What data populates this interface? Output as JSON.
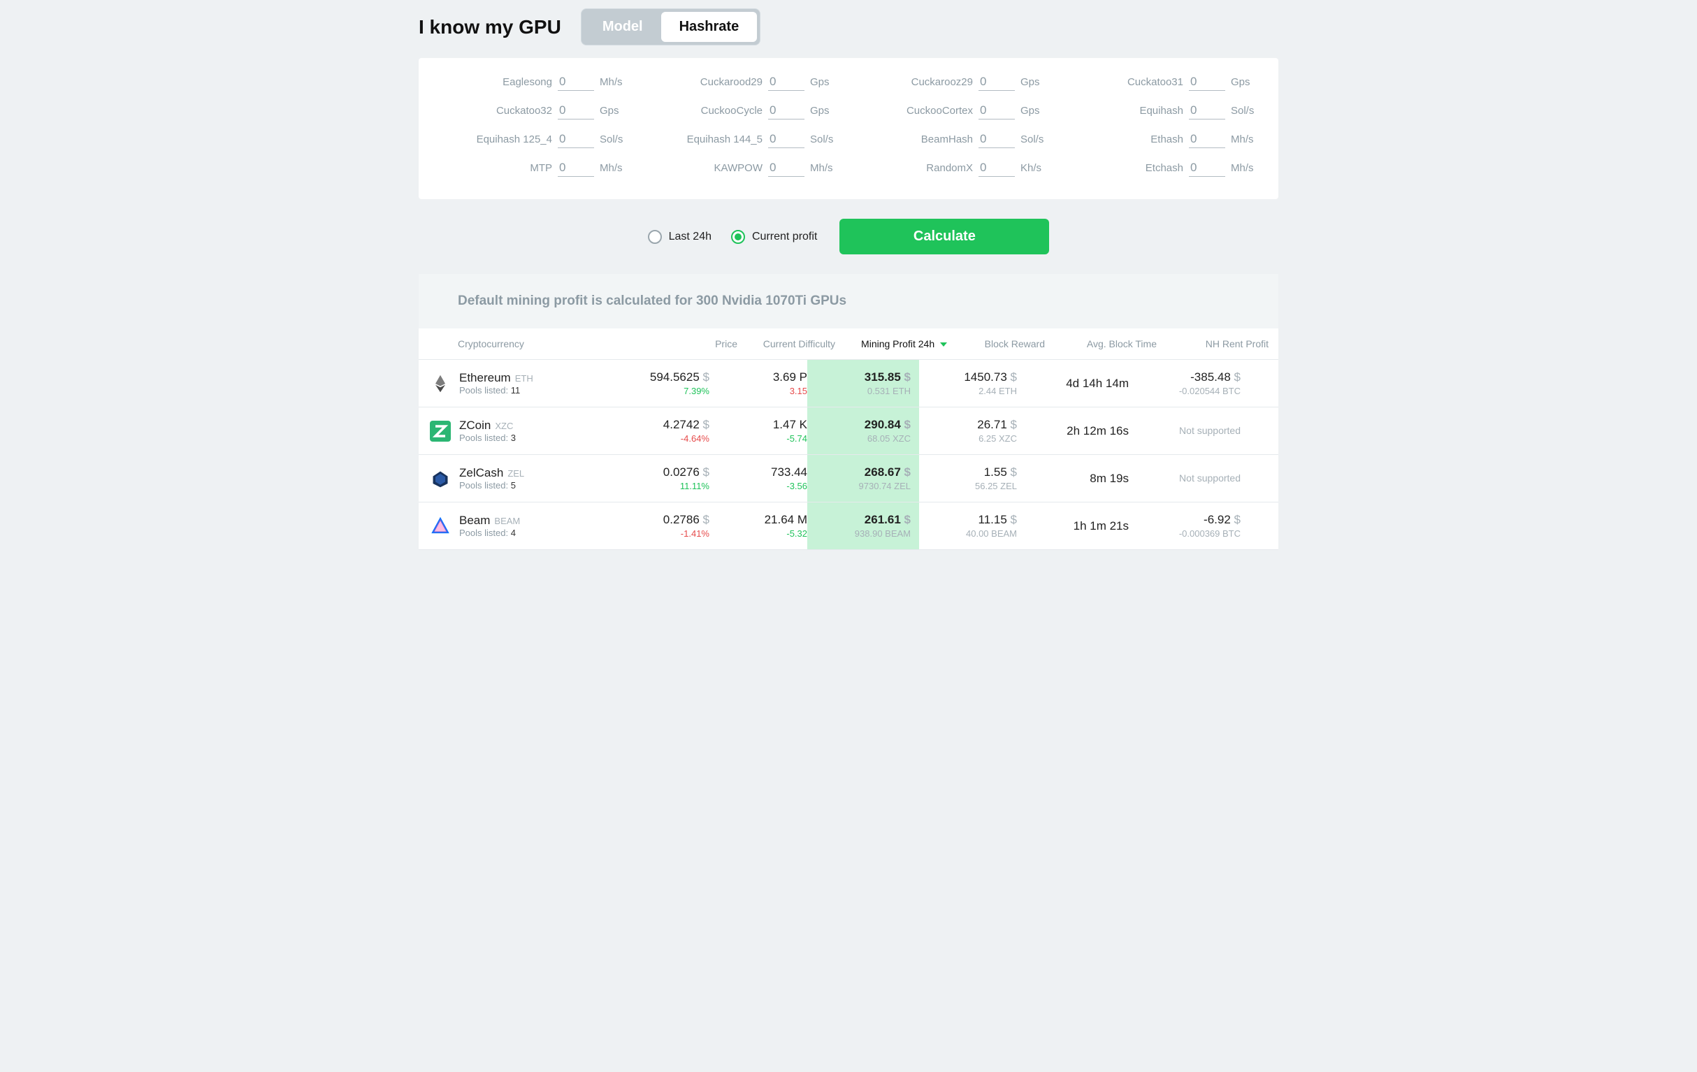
{
  "header": {
    "title": "I know my GPU",
    "toggle": {
      "model": "Model",
      "hashrate": "Hashrate",
      "active": "hashrate"
    }
  },
  "hashrate_inputs": [
    {
      "label": "Eaglesong",
      "value": "0",
      "unit": "Mh/s"
    },
    {
      "label": "Cuckarood29",
      "value": "0",
      "unit": "Gps"
    },
    {
      "label": "Cuckarooz29",
      "value": "0",
      "unit": "Gps"
    },
    {
      "label": "Cuckatoo31",
      "value": "0",
      "unit": "Gps"
    },
    {
      "label": "Cuckatoo32",
      "value": "0",
      "unit": "Gps"
    },
    {
      "label": "CuckooCycle",
      "value": "0",
      "unit": "Gps"
    },
    {
      "label": "CuckooCortex",
      "value": "0",
      "unit": "Gps"
    },
    {
      "label": "Equihash",
      "value": "0",
      "unit": "Sol/s"
    },
    {
      "label": "Equihash 125_4",
      "value": "0",
      "unit": "Sol/s"
    },
    {
      "label": "Equihash 144_5",
      "value": "0",
      "unit": "Sol/s"
    },
    {
      "label": "BeamHash",
      "value": "0",
      "unit": "Sol/s"
    },
    {
      "label": "Ethash",
      "value": "0",
      "unit": "Mh/s"
    },
    {
      "label": "MTP",
      "value": "0",
      "unit": "Mh/s"
    },
    {
      "label": "KAWPOW",
      "value": "0",
      "unit": "Mh/s"
    },
    {
      "label": "RandomX",
      "value": "0",
      "unit": "Kh/s"
    },
    {
      "label": "Etchash",
      "value": "0",
      "unit": "Mh/s"
    }
  ],
  "controls": {
    "radio": {
      "last24h": "Last 24h",
      "current": "Current profit",
      "selected": "current"
    },
    "calculate_label": "Calculate"
  },
  "note": "Default mining profit is calculated for 300 Nvidia 1070Ti GPUs",
  "columns": {
    "crypto": "Cryptocurrency",
    "price": "Price",
    "difficulty": "Current Difficulty",
    "profit": "Mining Profit 24h",
    "reward": "Block Reward",
    "blocktime": "Avg. Block Time",
    "rent": "NH Rent Profit"
  },
  "pools_label": "Pools listed:",
  "rows": [
    {
      "name": "Ethereum",
      "ticker": "ETH",
      "pools": "11",
      "price": "594.5625",
      "price_change": "7.39%",
      "price_dir": "up",
      "diff": "3.69 P",
      "diff_change": "3.15",
      "diff_dir": "up_red",
      "profit_usd": "315.85",
      "profit_sub": "0.531 ETH",
      "reward_usd": "1450.73",
      "reward_sub": "2.44 ETH",
      "blocktime": "4d 14h 14m",
      "rent_main": "-385.48",
      "rent_sub": "-0.020544 BTC",
      "rent_supported": true,
      "icon": "eth"
    },
    {
      "name": "ZCoin",
      "ticker": "XZC",
      "pools": "3",
      "price": "4.2742",
      "price_change": "-4.64%",
      "price_dir": "down",
      "diff": "1.47 K",
      "diff_change": "-5.74",
      "diff_dir": "down_green",
      "profit_usd": "290.84",
      "profit_sub": "68.05 XZC",
      "reward_usd": "26.71",
      "reward_sub": "6.25 XZC",
      "blocktime": "2h 12m 16s",
      "rent_main": "Not supported",
      "rent_sub": "",
      "rent_supported": false,
      "icon": "xzc"
    },
    {
      "name": "ZelCash",
      "ticker": "ZEL",
      "pools": "5",
      "price": "0.0276",
      "price_change": "11.11%",
      "price_dir": "up",
      "diff": "733.44",
      "diff_change": "-3.56",
      "diff_dir": "down_green",
      "profit_usd": "268.67",
      "profit_sub": "9730.74 ZEL",
      "reward_usd": "1.55",
      "reward_sub": "56.25 ZEL",
      "blocktime": "8m 19s",
      "rent_main": "Not supported",
      "rent_sub": "",
      "rent_supported": false,
      "icon": "zel"
    },
    {
      "name": "Beam",
      "ticker": "BEAM",
      "pools": "4",
      "price": "0.2786",
      "price_change": "-1.41%",
      "price_dir": "down",
      "diff": "21.64 M",
      "diff_change": "-5.32",
      "diff_dir": "down_green",
      "profit_usd": "261.61",
      "profit_sub": "938.90 BEAM",
      "reward_usd": "11.15",
      "reward_sub": "40.00 BEAM",
      "blocktime": "1h 1m 21s",
      "rent_main": "-6.92",
      "rent_sub": "-0.000369 BTC",
      "rent_supported": true,
      "icon": "beam"
    }
  ]
}
